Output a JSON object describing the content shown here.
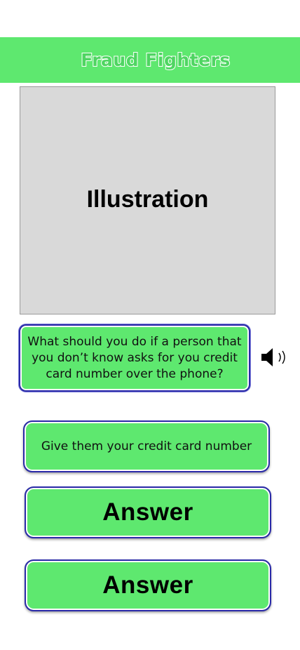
{
  "app": {
    "title": "Fraud Fighters"
  },
  "illustration": {
    "label": "Illustration"
  },
  "question": {
    "text": "What should you do if a person that you don’t know asks for you credit card number over the phone?",
    "audio_icon": "speaker-icon"
  },
  "answers": [
    {
      "label": "Give them your credit card number"
    },
    {
      "label": "Answer"
    },
    {
      "label": "Answer"
    }
  ],
  "colors": {
    "accent_green": "#5ee86f",
    "border_blue": "#2a2aa8",
    "placeholder_gray": "#d9d9d9"
  }
}
